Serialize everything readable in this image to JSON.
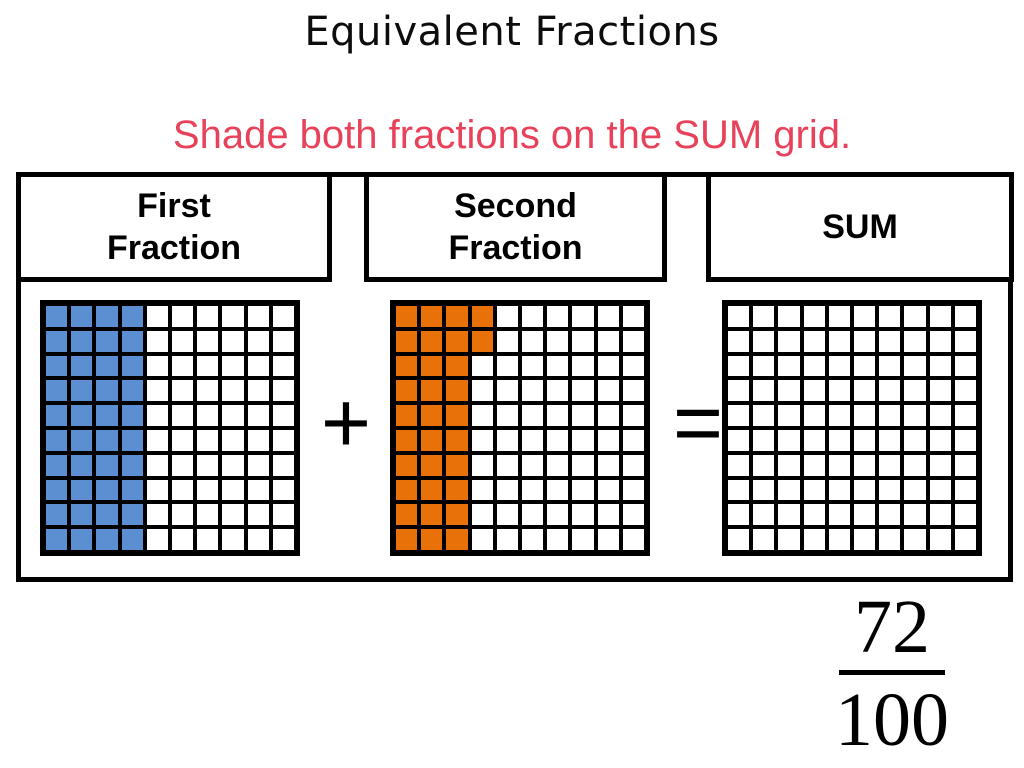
{
  "slide": {
    "title": "Equivalent Fractions",
    "instruction": "Shade both fractions on the SUM grid.",
    "instruction_color": "#E8425B"
  },
  "headers": {
    "first": {
      "line1": "First",
      "line2": "Fraction"
    },
    "second": {
      "line1": "Second",
      "line2": "Fraction"
    },
    "sum": {
      "line1": "SUM",
      "line2": ""
    }
  },
  "operators": {
    "plus": "+",
    "equals": "=",
    "plus_name": "plus-sign",
    "equals_name": "equals-sign"
  },
  "answer": {
    "numerator": "72",
    "denominator": "100"
  },
  "colors": {
    "blue": "#5B8FD1",
    "orange": "#E8710A",
    "outline": "#000000",
    "empty": "#FFFFFF"
  },
  "chart_data": {
    "type": "grid-shading",
    "title": "Equivalent Fractions",
    "subtitle": "Shade both fractions on the SUM grid.",
    "grid_rows": 10,
    "grid_cols": 10,
    "cells_total": 100,
    "grids": [
      {
        "name": "first-fraction",
        "label": "First Fraction",
        "color": "#5B8FD1",
        "shaded_count": 40,
        "fraction": "40/100",
        "shaded_rows": [
          [
            1,
            1,
            1,
            1,
            0,
            0,
            0,
            0,
            0,
            0
          ],
          [
            1,
            1,
            1,
            1,
            0,
            0,
            0,
            0,
            0,
            0
          ],
          [
            1,
            1,
            1,
            1,
            0,
            0,
            0,
            0,
            0,
            0
          ],
          [
            1,
            1,
            1,
            1,
            0,
            0,
            0,
            0,
            0,
            0
          ],
          [
            1,
            1,
            1,
            1,
            0,
            0,
            0,
            0,
            0,
            0
          ],
          [
            1,
            1,
            1,
            1,
            0,
            0,
            0,
            0,
            0,
            0
          ],
          [
            1,
            1,
            1,
            1,
            0,
            0,
            0,
            0,
            0,
            0
          ],
          [
            1,
            1,
            1,
            1,
            0,
            0,
            0,
            0,
            0,
            0
          ],
          [
            1,
            1,
            1,
            1,
            0,
            0,
            0,
            0,
            0,
            0
          ],
          [
            1,
            1,
            1,
            1,
            0,
            0,
            0,
            0,
            0,
            0
          ]
        ]
      },
      {
        "name": "second-fraction",
        "label": "Second Fraction",
        "color": "#E8710A",
        "shaded_count": 32,
        "fraction": "32/100",
        "shaded_rows": [
          [
            1,
            1,
            1,
            1,
            0,
            0,
            0,
            0,
            0,
            0
          ],
          [
            1,
            1,
            1,
            1,
            0,
            0,
            0,
            0,
            0,
            0
          ],
          [
            1,
            1,
            1,
            0,
            0,
            0,
            0,
            0,
            0,
            0
          ],
          [
            1,
            1,
            1,
            0,
            0,
            0,
            0,
            0,
            0,
            0
          ],
          [
            1,
            1,
            1,
            0,
            0,
            0,
            0,
            0,
            0,
            0
          ],
          [
            1,
            1,
            1,
            0,
            0,
            0,
            0,
            0,
            0,
            0
          ],
          [
            1,
            1,
            1,
            0,
            0,
            0,
            0,
            0,
            0,
            0
          ],
          [
            1,
            1,
            1,
            0,
            0,
            0,
            0,
            0,
            0,
            0
          ],
          [
            1,
            1,
            1,
            0,
            0,
            0,
            0,
            0,
            0,
            0
          ],
          [
            1,
            1,
            1,
            0,
            0,
            0,
            0,
            0,
            0,
            0
          ]
        ]
      },
      {
        "name": "sum",
        "label": "SUM",
        "color": "#FFFFFF",
        "shaded_count": 0,
        "fraction": "72/100",
        "shaded_rows": [
          [
            0,
            0,
            0,
            0,
            0,
            0,
            0,
            0,
            0,
            0
          ],
          [
            0,
            0,
            0,
            0,
            0,
            0,
            0,
            0,
            0,
            0
          ],
          [
            0,
            0,
            0,
            0,
            0,
            0,
            0,
            0,
            0,
            0
          ],
          [
            0,
            0,
            0,
            0,
            0,
            0,
            0,
            0,
            0,
            0
          ],
          [
            0,
            0,
            0,
            0,
            0,
            0,
            0,
            0,
            0,
            0
          ],
          [
            0,
            0,
            0,
            0,
            0,
            0,
            0,
            0,
            0,
            0
          ],
          [
            0,
            0,
            0,
            0,
            0,
            0,
            0,
            0,
            0,
            0
          ],
          [
            0,
            0,
            0,
            0,
            0,
            0,
            0,
            0,
            0,
            0
          ],
          [
            0,
            0,
            0,
            0,
            0,
            0,
            0,
            0,
            0,
            0
          ],
          [
            0,
            0,
            0,
            0,
            0,
            0,
            0,
            0,
            0,
            0
          ]
        ]
      }
    ]
  }
}
